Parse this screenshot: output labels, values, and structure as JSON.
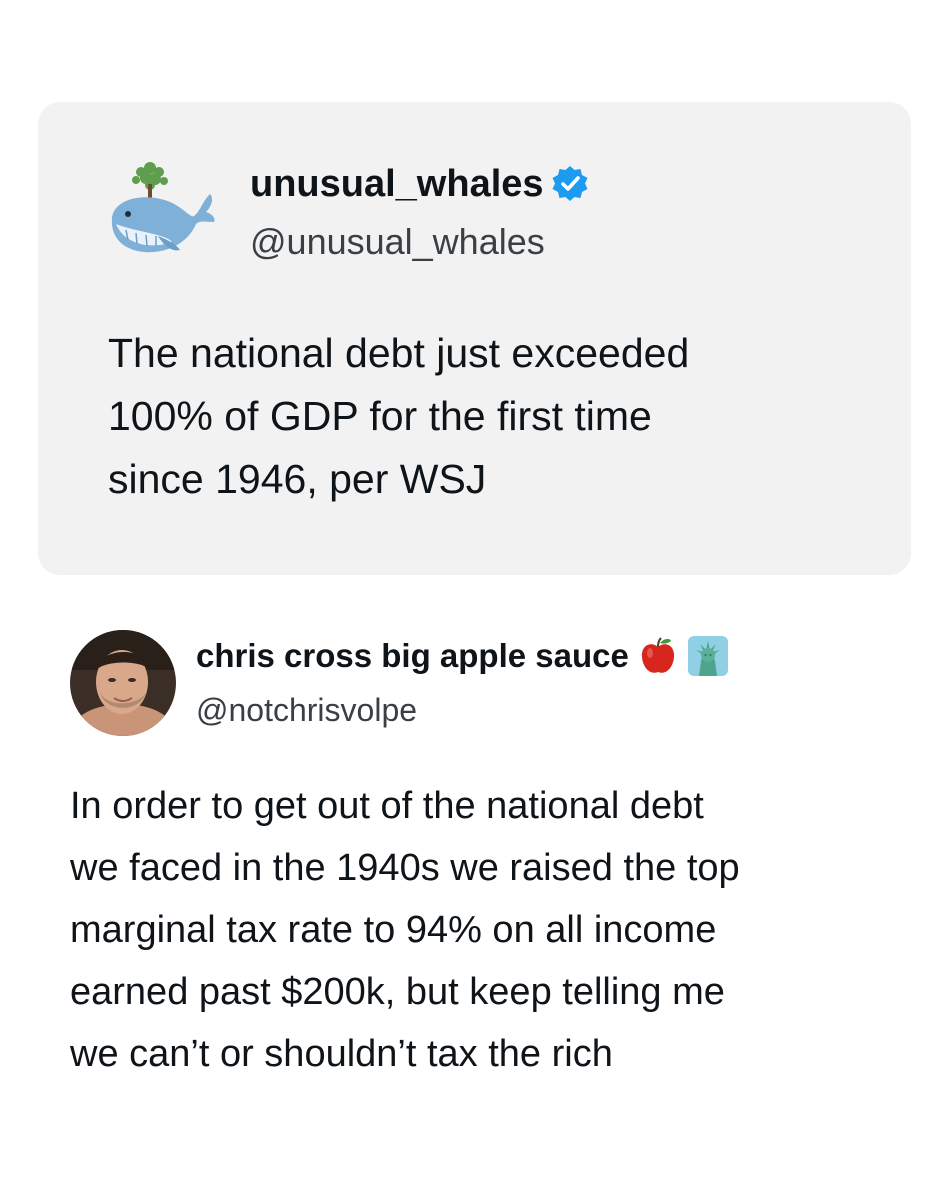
{
  "quoted_post": {
    "display_name": "unusual_whales",
    "handle": "@unusual_whales",
    "verified_icon": "verified-badge-icon",
    "avatar_icon": "whale-icon",
    "text_lines": [
      "The national debt just exceeded",
      "100% of GDP for the first time",
      "since 1946, per WSJ"
    ]
  },
  "reply_post": {
    "display_name": "chris cross big apple sauce",
    "handle": "@notchrisvolpe",
    "name_emojis": [
      "apple-emoji-icon",
      "statue-of-liberty-emoji-icon"
    ],
    "avatar_icon": "profile-photo",
    "text_lines": [
      "In order to get out of the national debt",
      "we faced in the 1940s we raised the top",
      "marginal tax rate to 94% on all income",
      "earned past $200k, but keep telling me",
      "we can’t or shouldn’t tax the rich"
    ]
  },
  "colors": {
    "card_background": "#f2f2f2",
    "verified_blue": "#1d9bf0",
    "text_primary": "#0f1419",
    "text_secondary": "#3a3f44"
  }
}
